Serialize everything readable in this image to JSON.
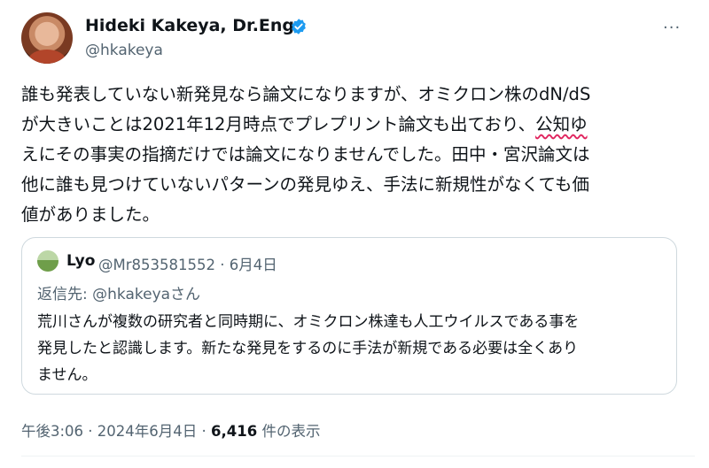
{
  "author": {
    "name": "Hideki Kakeya, Dr.Eng.",
    "handle": "@hkakeya"
  },
  "tweet": {
    "lines": [
      "誰も発表していない新発見なら論文になりますが、オミクロン株のdN/dS",
      "が大きいことは2021年12月時点でプレプリント論文も出ており、",
      "えにその事実の指摘だけでは論文になりませんでした。田中・宮沢論文は",
      "他に誰も見つけていないパターンの発見ゆえ、手法に新規性がなくても価",
      "値がありました。"
    ],
    "underlined_text": "公知ゆ"
  },
  "quoted": {
    "name": "Lyo",
    "meta": "@Mr853581552 · 6月4日",
    "reply_prefix": "返信先: ",
    "reply_to": "@hkakeyaさん",
    "lines": [
      "荒川さんが複数の研究者と同時期に、オミクロン株達も人工ウイルスである事を",
      "発見したと認識します。新たな発見をするのに手法が新規である必要は全くあり",
      "ません。"
    ]
  },
  "footer": {
    "time": "午後3:06 · 2024年6月4日 · ",
    "views_count": "6,416",
    "views_label": " 件の表示"
  },
  "more_label": "···",
  "colors": {
    "accent": "#1d9bf0",
    "text": "#0f1419",
    "muted": "#536471",
    "border": "#cfd9de"
  }
}
